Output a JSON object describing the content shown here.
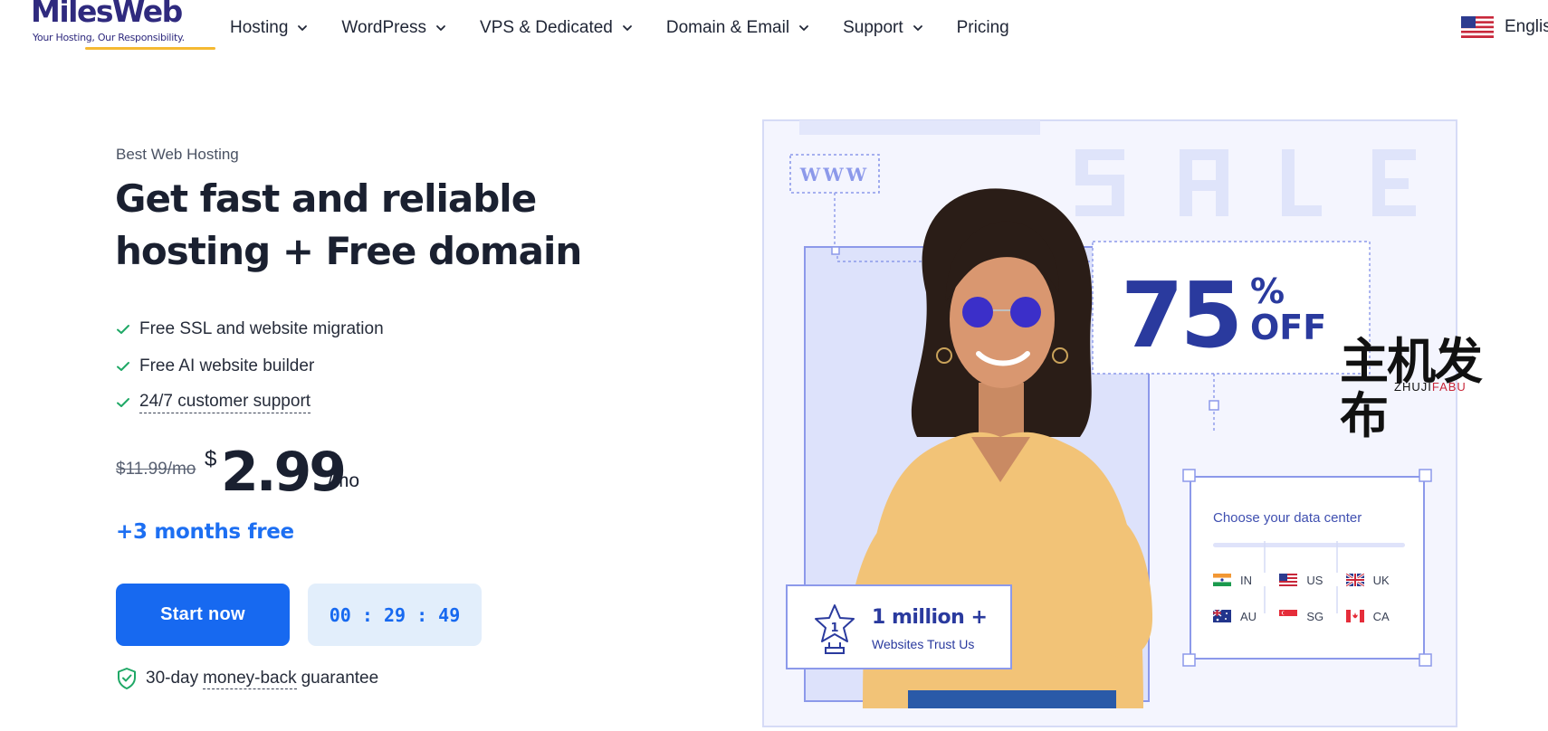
{
  "brand": {
    "name": "MilesWeb",
    "tagline": "Your Hosting, Our Responsibility.",
    "colors": {
      "primary": "#2f2a7e",
      "accent": "#f5b931",
      "cta": "#1769f0"
    }
  },
  "nav": {
    "items": [
      {
        "label": "Hosting",
        "has_dropdown": true
      },
      {
        "label": "WordPress",
        "has_dropdown": true
      },
      {
        "label": "VPS & Dedicated",
        "has_dropdown": true
      },
      {
        "label": "Domain & Email",
        "has_dropdown": true
      },
      {
        "label": "Support",
        "has_dropdown": true
      },
      {
        "label": "Pricing",
        "has_dropdown": false
      }
    ],
    "language": {
      "label": "Englis",
      "flag_icon": "us-flag-icon"
    }
  },
  "hero": {
    "eyebrow": "Best Web Hosting",
    "headline_line1": "Get fast and reliable",
    "headline_line2": "hosting + Free domain",
    "features": [
      {
        "text": "Free SSL and website migration",
        "underlined": false
      },
      {
        "text": "Free AI website builder",
        "underlined": false
      },
      {
        "text": "24/7 customer support",
        "underlined": true
      }
    ],
    "price": {
      "old": "$11.99/mo",
      "currency": "$",
      "amount": "2.99",
      "period": "/mo"
    },
    "bonus": "+3 months free",
    "cta_label": "Start now",
    "timer": "00 : 29 : 49",
    "guarantee": {
      "prefix": "30-day",
      "link": "money-back",
      "suffix": "guarantee"
    }
  },
  "promo": {
    "sale_word": "SALE",
    "www": "WWW",
    "discount_number": "75",
    "discount_percent": "%",
    "discount_off": "OFF",
    "data_center": {
      "title": "Choose your data center",
      "locations": [
        {
          "code": "IN",
          "flag_icon": "india-flag-icon"
        },
        {
          "code": "US",
          "flag_icon": "us-flag-icon"
        },
        {
          "code": "UK",
          "flag_icon": "uk-flag-icon"
        },
        {
          "code": "AU",
          "flag_icon": "australia-flag-icon"
        },
        {
          "code": "SG",
          "flag_icon": "singapore-flag-icon"
        },
        {
          "code": "CA",
          "flag_icon": "canada-flag-icon"
        }
      ]
    },
    "trust": {
      "big": "1 million +",
      "small": "Websites Trust Us",
      "badge_number": "1"
    }
  },
  "watermark": {
    "cn": "主机发布",
    "en_part1": "ZHUJI",
    "en_part2": "FABU"
  }
}
